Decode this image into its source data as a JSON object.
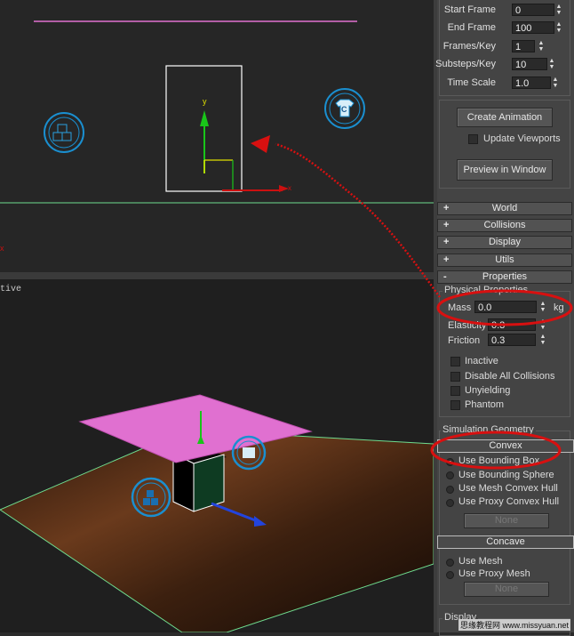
{
  "time_config": {
    "start_frame": {
      "label": "Start Frame",
      "value": "0"
    },
    "end_frame": {
      "label": "End Frame",
      "value": "100"
    },
    "frames_key": {
      "label": "Frames/Key",
      "value": "1"
    },
    "substeps_key": {
      "label": "Substeps/Key",
      "value": "10"
    },
    "time_scale": {
      "label": "Time Scale",
      "value": "1.0"
    }
  },
  "buttons": {
    "create_animation": "Create Animation",
    "update_viewports": "Update Viewports",
    "preview_in_window": "Preview in Window"
  },
  "rollouts": [
    {
      "sign": "+",
      "label": "World"
    },
    {
      "sign": "+",
      "label": "Collisions"
    },
    {
      "sign": "+",
      "label": "Display"
    },
    {
      "sign": "+",
      "label": "Utils"
    },
    {
      "sign": "-",
      "label": "Properties"
    }
  ],
  "physical_properties": {
    "title": "Physical Properties",
    "mass": {
      "label": "Mass",
      "value": "0.0",
      "unit": "kg"
    },
    "elasticity": {
      "label": "Elasticity",
      "value": "0.3"
    },
    "friction": {
      "label": "Friction",
      "value": "0.3"
    }
  },
  "flags": {
    "inactive": "Inactive",
    "disable_all_collisions": "Disable All Collisions",
    "unyielding": "Unyielding",
    "phantom": "Phantom"
  },
  "simulation_geometry": {
    "title": "Simulation Geometry",
    "convex": "Convex",
    "use_bounding_box": "Use Bounding Box",
    "use_bounding_sphere": "Use Bounding Sphere",
    "use_mesh_convex_hull": "Use Mesh Convex Hull",
    "use_proxy_convex_hull": "Use Proxy Convex Hull",
    "none_1": "None",
    "concave": "Concave",
    "use_mesh": "Use Mesh",
    "use_proxy_mesh": "Use Proxy Mesh",
    "none_2": "None",
    "selected": "use_bounding_box"
  },
  "display_group": {
    "title": "Display"
  },
  "viewport": {
    "top_axis_y": "y",
    "top_axis_x": "x",
    "persp_label": "tive",
    "corner_x": "x"
  },
  "watermark": "思缘教程网 www.missyuan.net",
  "colors": {
    "annotation": "#d81010",
    "plane": "#e070d0",
    "helper": "#1a8fd0"
  }
}
